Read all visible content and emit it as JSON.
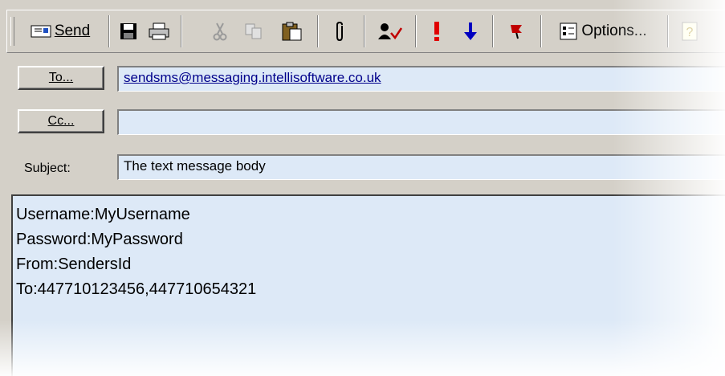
{
  "toolbar": {
    "send_label": "Send",
    "options_label": "Options...",
    "icons": [
      "send-icon",
      "save-icon",
      "print-icon",
      "cut-icon",
      "copy-icon",
      "paste-icon",
      "attach-icon",
      "check-names-icon",
      "high-importance-icon",
      "low-importance-icon",
      "flag-icon",
      "options-icon",
      "help-icon"
    ]
  },
  "header": {
    "to_button_label": "To...",
    "cc_button_label": "Cc...",
    "subject_label": "Subject:",
    "to_value": "sendsms@messaging.intellisoftware.co.uk",
    "cc_value": "",
    "subject_value": "The text message body"
  },
  "body": {
    "text": "Username:MyUsername\nPassword:MyPassword\nFrom:SendersId\nTo:447710123456,447710654321"
  },
  "colors": {
    "chrome": "#d4d0c8",
    "field_bg": "#dde9f7",
    "link": "#00008b",
    "importance_high": "#e00000",
    "importance_low": "#0000c0",
    "flag": "#c00000"
  }
}
